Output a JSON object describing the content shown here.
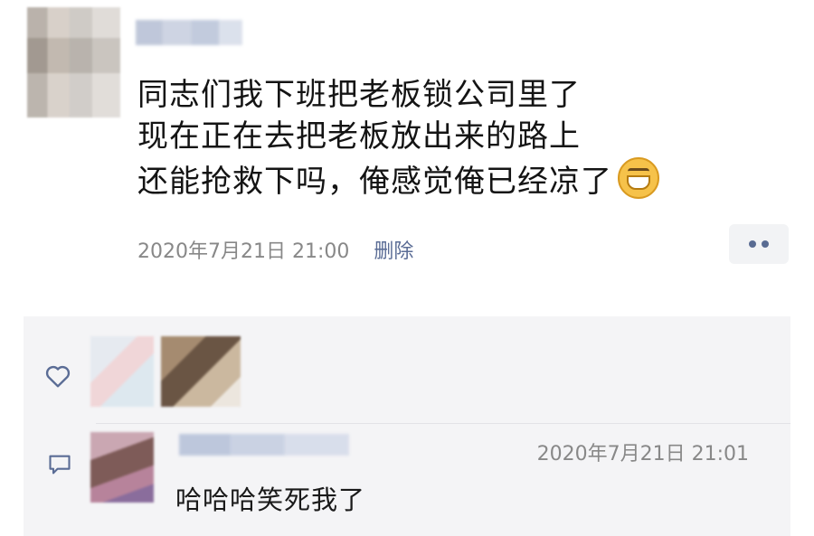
{
  "post": {
    "lines": [
      "同志们我下班把老板锁公司里了",
      "现在正在去把老板放出来的路上",
      "还能抢救下吗，俺感觉俺已经凉了"
    ],
    "emoji": "grinning-face-icon",
    "time": "2020年7月21日 21:00",
    "delete_label": "删除"
  },
  "comment": {
    "time": "2020年7月21日 21:01",
    "text": "哈哈哈笑死我了"
  },
  "colors": {
    "link": "#5a6c95",
    "meta": "#888888",
    "comment_bg": "#f4f4f6"
  }
}
